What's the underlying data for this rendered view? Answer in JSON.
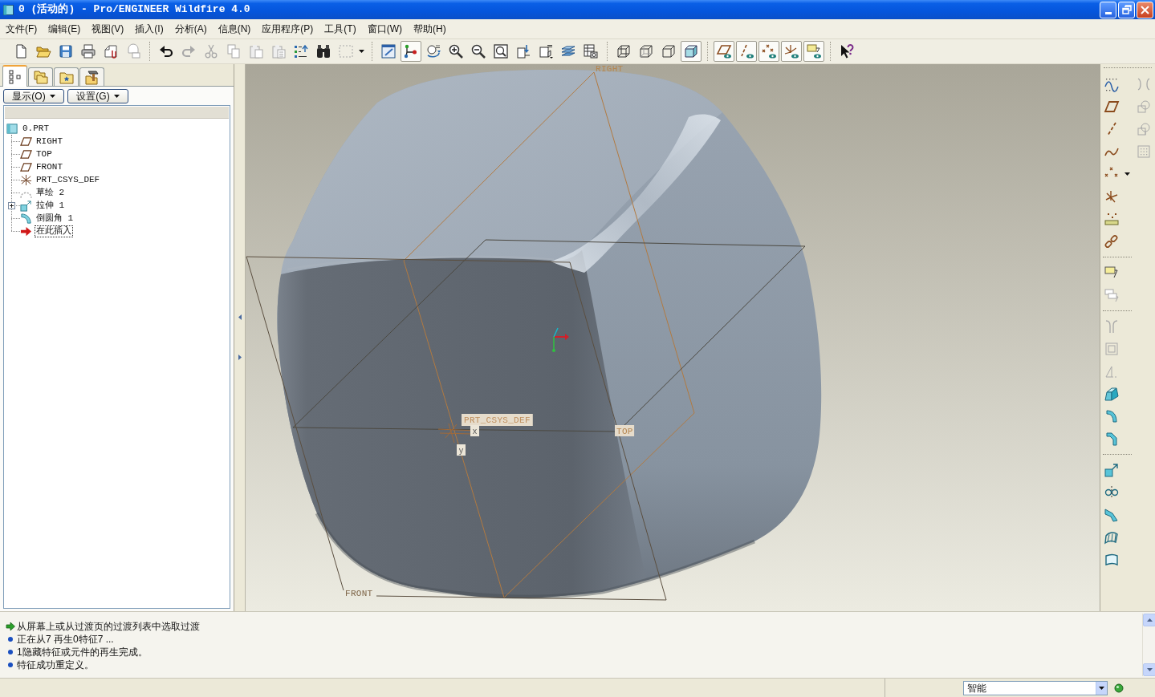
{
  "window": {
    "title": "0 (活动的) - Pro/ENGINEER Wildfire 4.0"
  },
  "menu": [
    {
      "label": "文件(F)"
    },
    {
      "label": "编辑(E)"
    },
    {
      "label": "视图(V)"
    },
    {
      "label": "插入(I)"
    },
    {
      "label": "分析(A)"
    },
    {
      "label": "信息(N)"
    },
    {
      "label": "应用程序(P)"
    },
    {
      "label": "工具(T)"
    },
    {
      "label": "窗口(W)"
    },
    {
      "label": "帮助(H)"
    }
  ],
  "toolbar": [
    {
      "items": [
        {
          "kind": "new",
          "disabled": false,
          "pressed": false
        },
        {
          "kind": "open",
          "disabled": false,
          "pressed": false
        },
        {
          "kind": "save",
          "disabled": false,
          "pressed": false
        },
        {
          "kind": "print",
          "disabled": false,
          "pressed": false
        },
        {
          "kind": "send",
          "disabled": false,
          "pressed": false
        },
        {
          "kind": "sendall",
          "disabled": true,
          "pressed": false
        }
      ]
    },
    {
      "items": [
        {
          "kind": "undo",
          "disabled": false,
          "pressed": false
        },
        {
          "kind": "redo",
          "disabled": true,
          "pressed": false
        },
        {
          "kind": "cut",
          "disabled": true,
          "pressed": false
        },
        {
          "kind": "copy",
          "disabled": true,
          "pressed": false
        },
        {
          "kind": "paste",
          "disabled": true,
          "pressed": false
        },
        {
          "kind": "pastespecial",
          "disabled": true,
          "pressed": false
        },
        {
          "kind": "regenerate",
          "disabled": false,
          "pressed": false
        },
        {
          "kind": "find",
          "disabled": false,
          "pressed": false
        },
        {
          "kind": "select",
          "disabled": true,
          "pressed": false,
          "dropdown": true
        }
      ]
    },
    {
      "items": [
        {
          "kind": "repaint",
          "disabled": false,
          "pressed": false
        },
        {
          "kind": "spin",
          "disabled": false,
          "pressed": true
        },
        {
          "kind": "orient",
          "disabled": false,
          "pressed": false
        },
        {
          "kind": "zoomin",
          "disabled": false,
          "pressed": false
        },
        {
          "kind": "zoomout",
          "disabled": false,
          "pressed": false
        },
        {
          "kind": "refit",
          "disabled": false,
          "pressed": false
        },
        {
          "kind": "reorient",
          "disabled": false,
          "pressed": false
        },
        {
          "kind": "views",
          "disabled": false,
          "pressed": false
        },
        {
          "kind": "layers",
          "disabled": false,
          "pressed": false
        },
        {
          "kind": "viewmanager",
          "disabled": false,
          "pressed": false
        }
      ]
    },
    {
      "items": [
        {
          "kind": "wireframe",
          "disabled": false,
          "pressed": false
        },
        {
          "kind": "hiddenline",
          "disabled": false,
          "pressed": false
        },
        {
          "kind": "nohidden",
          "disabled": false,
          "pressed": false
        },
        {
          "kind": "shaded",
          "disabled": false,
          "pressed": true
        }
      ]
    },
    {
      "items": [
        {
          "kind": "planes",
          "disabled": false,
          "pressed": true
        },
        {
          "kind": "axes",
          "disabled": false,
          "pressed": true
        },
        {
          "kind": "points",
          "disabled": false,
          "pressed": true
        },
        {
          "kind": "csys",
          "disabled": false,
          "pressed": true
        },
        {
          "kind": "annotations",
          "disabled": false,
          "pressed": true
        }
      ]
    },
    {
      "items": [
        {
          "kind": "help",
          "disabled": false,
          "pressed": false
        }
      ]
    }
  ],
  "panel_tabs": [
    {
      "kind": "tree",
      "selected": true
    },
    {
      "kind": "layers",
      "selected": false
    },
    {
      "kind": "folder",
      "selected": false
    },
    {
      "kind": "tools",
      "selected": false
    }
  ],
  "panel_buttons": [
    {
      "label": "显示(O)"
    },
    {
      "label": "设置(G)"
    }
  ],
  "model_tree": {
    "items": [
      {
        "kind": "part",
        "label": "0.PRT",
        "focused": false,
        "children": [
          {
            "kind": "plane",
            "label": "RIGHT",
            "focused": false
          },
          {
            "kind": "plane",
            "label": "TOP",
            "focused": false
          },
          {
            "kind": "plane",
            "label": "FRONT",
            "focused": false
          },
          {
            "kind": "csys",
            "label": "PRT_CSYS_DEF",
            "focused": false
          },
          {
            "kind": "sketch",
            "label": "草绘 2",
            "focused": false
          },
          {
            "kind": "extrude",
            "label": "拉伸 1",
            "focused": false,
            "expanded": false
          },
          {
            "kind": "round",
            "label": "倒圆角 1",
            "focused": false
          },
          {
            "kind": "insert",
            "label": "在此插入",
            "focused": true
          }
        ]
      }
    ]
  },
  "viewport": {
    "datum_planes": [
      {
        "name": "RIGHT"
      },
      {
        "name": "TOP"
      },
      {
        "name": "FRONT"
      }
    ],
    "csys": {
      "name": "PRT_CSYS_DEF",
      "axes": [
        "x",
        "y"
      ]
    }
  },
  "feature_toolbar": {
    "groups": [
      {
        "items": [
          {
            "kind": "sketch",
            "disabled": false
          },
          {
            "kind": "plane",
            "disabled": false
          },
          {
            "kind": "axis",
            "disabled": false
          },
          {
            "kind": "curve",
            "disabled": false
          },
          {
            "kind": "point",
            "disabled": false,
            "dropdown": true
          },
          {
            "kind": "csys",
            "disabled": false
          },
          {
            "kind": "analysis",
            "disabled": false
          },
          {
            "kind": "chain",
            "disabled": false
          }
        ]
      },
      {
        "items": [
          {
            "kind": "note",
            "disabled": false
          },
          {
            "kind": "notes",
            "disabled": true
          }
        ]
      },
      {
        "items": [
          {
            "kind": "hole",
            "disabled": true
          },
          {
            "kind": "shell",
            "disabled": true
          },
          {
            "kind": "rib",
            "disabled": true
          },
          {
            "kind": "draft",
            "disabled": false
          },
          {
            "kind": "round",
            "disabled": false
          },
          {
            "kind": "chamfer",
            "disabled": false
          }
        ]
      },
      {
        "items": [
          {
            "kind": "extrude",
            "disabled": false
          },
          {
            "kind": "mirror",
            "disabled": false
          },
          {
            "kind": "sweep",
            "disabled": false
          },
          {
            "kind": "surface",
            "disabled": false
          },
          {
            "kind": "patch",
            "disabled": false
          }
        ]
      }
    ],
    "secondary": [
      {
        "kind": "brackets",
        "disabled": true
      },
      {
        "kind": "merge",
        "disabled": true
      },
      {
        "kind": "intersect",
        "disabled": true
      },
      {
        "kind": "grid",
        "disabled": true
      }
    ]
  },
  "messages": [
    {
      "kind": "prompt",
      "text": "从屏幕上或从过渡页的过渡列表中选取过渡"
    },
    {
      "kind": "info",
      "text": "正在从7 再生0特征7 ..."
    },
    {
      "kind": "info",
      "text": "1隐藏特征或元件的再生完成。"
    },
    {
      "kind": "info",
      "text": "特征成功重定义。"
    }
  ],
  "status_bar": {
    "filter": {
      "value": "智能"
    }
  }
}
